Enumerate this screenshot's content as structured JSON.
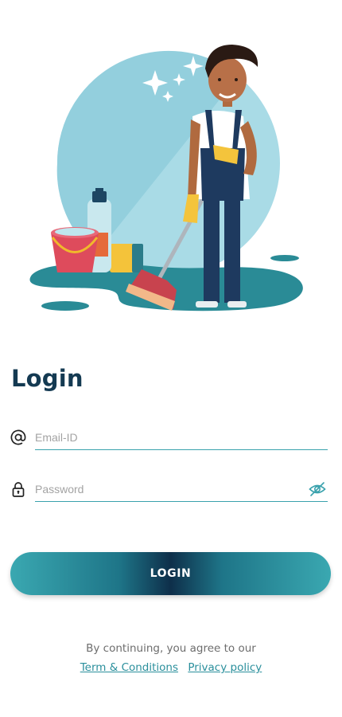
{
  "hero": {
    "illustration": "cleaning-person-with-broom-illustration"
  },
  "login": {
    "title": "Login",
    "email_placeholder": "Email-ID",
    "email_value": "",
    "password_placeholder": "Password",
    "password_value": "",
    "button_label": "LOGIN"
  },
  "footer": {
    "consent_text": "By continuing, you agree to our",
    "terms_label": "Term & Conditions",
    "privacy_label": "Privacy policy"
  },
  "icons": {
    "email": "at-icon",
    "password": "lock-icon",
    "toggle": "eye-off-icon"
  },
  "colors": {
    "title": "#143a52",
    "accent": "#3aa2ad",
    "link": "#2a8f9c",
    "button_dark": "#0e2f4a",
    "button_light": "#3aa8b1"
  }
}
